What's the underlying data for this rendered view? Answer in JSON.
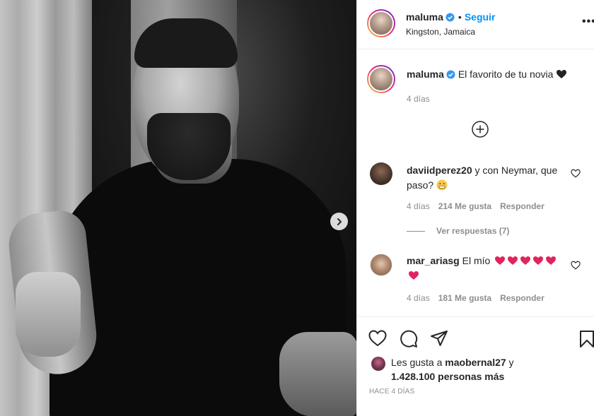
{
  "post": {
    "username": "maluma",
    "follow_label": "Seguir",
    "dot": "•",
    "location": "Kingston, Jamaica",
    "more": "•••"
  },
  "caption": {
    "username": "maluma",
    "text": "El favorito de tu novia",
    "time": "4 días"
  },
  "comments": [
    {
      "username": "daviidperez20",
      "text": "y con Neymar, que paso?",
      "time": "4 días",
      "likes": "214 Me gusta",
      "reply": "Responder",
      "replies": "Ver respuestas (7)"
    },
    {
      "username": "mar_ariasg",
      "text": "El mío",
      "time": "4 días",
      "likes": "181 Me gusta",
      "reply": "Responder"
    }
  ],
  "likes": {
    "prefix": "Les gusta a ",
    "user": "maobernal27",
    "mid": " y",
    "count": "1.428.100 personas más"
  },
  "ago": "HACE 4 DÍAS",
  "colors": {
    "accent": "#0095f6",
    "heart": "#e0245e"
  },
  "icons": [
    "verified-icon",
    "add-circle-icon",
    "heart-icon",
    "comment-icon",
    "share-icon",
    "bookmark-icon",
    "chevron-right-icon"
  ]
}
